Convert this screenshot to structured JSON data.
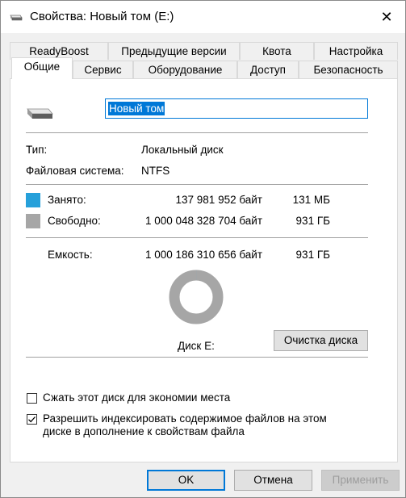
{
  "window": {
    "title": "Свойства: Новый том (E:)",
    "close_glyph": "✕"
  },
  "tabs_row1": [
    {
      "label": "ReadyBoost"
    },
    {
      "label": "Предыдущие версии"
    },
    {
      "label": "Квота"
    },
    {
      "label": "Настройка"
    }
  ],
  "tabs_row2": [
    {
      "label": "Общие"
    },
    {
      "label": "Сервис"
    },
    {
      "label": "Оборудование"
    },
    {
      "label": "Доступ"
    },
    {
      "label": "Безопасность"
    }
  ],
  "active_tab": "Общие",
  "general": {
    "volume_name": "Новый том",
    "type_label": "Тип:",
    "type_value": "Локальный диск",
    "fs_label": "Файловая система:",
    "fs_value": "NTFS",
    "used_label": "Занято:",
    "used_bytes": "137 981 952 байт",
    "used_short": "131 МБ",
    "free_label": "Свободно:",
    "free_bytes": "1 000 048 328 704 байт",
    "free_short": "931 ГБ",
    "capacity_label": "Емкость:",
    "capacity_bytes": "1 000 186 310 656 байт",
    "capacity_short": "931 ГБ",
    "disk_label": "Диск E:",
    "cleanup_button": "Очистка диска",
    "used_fraction": 0.000138,
    "colors": {
      "used": "#26a0da",
      "free": "#a6a6a6"
    }
  },
  "options": {
    "compress_label": "Сжать этот диск для экономии места",
    "compress_checked": false,
    "index_label_line1": "Разрешить индексировать содержимое файлов на этом",
    "index_label_line2": "диске в дополнение к свойствам файла",
    "index_checked": true
  },
  "footer": {
    "ok": "OK",
    "cancel": "Отмена",
    "apply": "Применить"
  }
}
